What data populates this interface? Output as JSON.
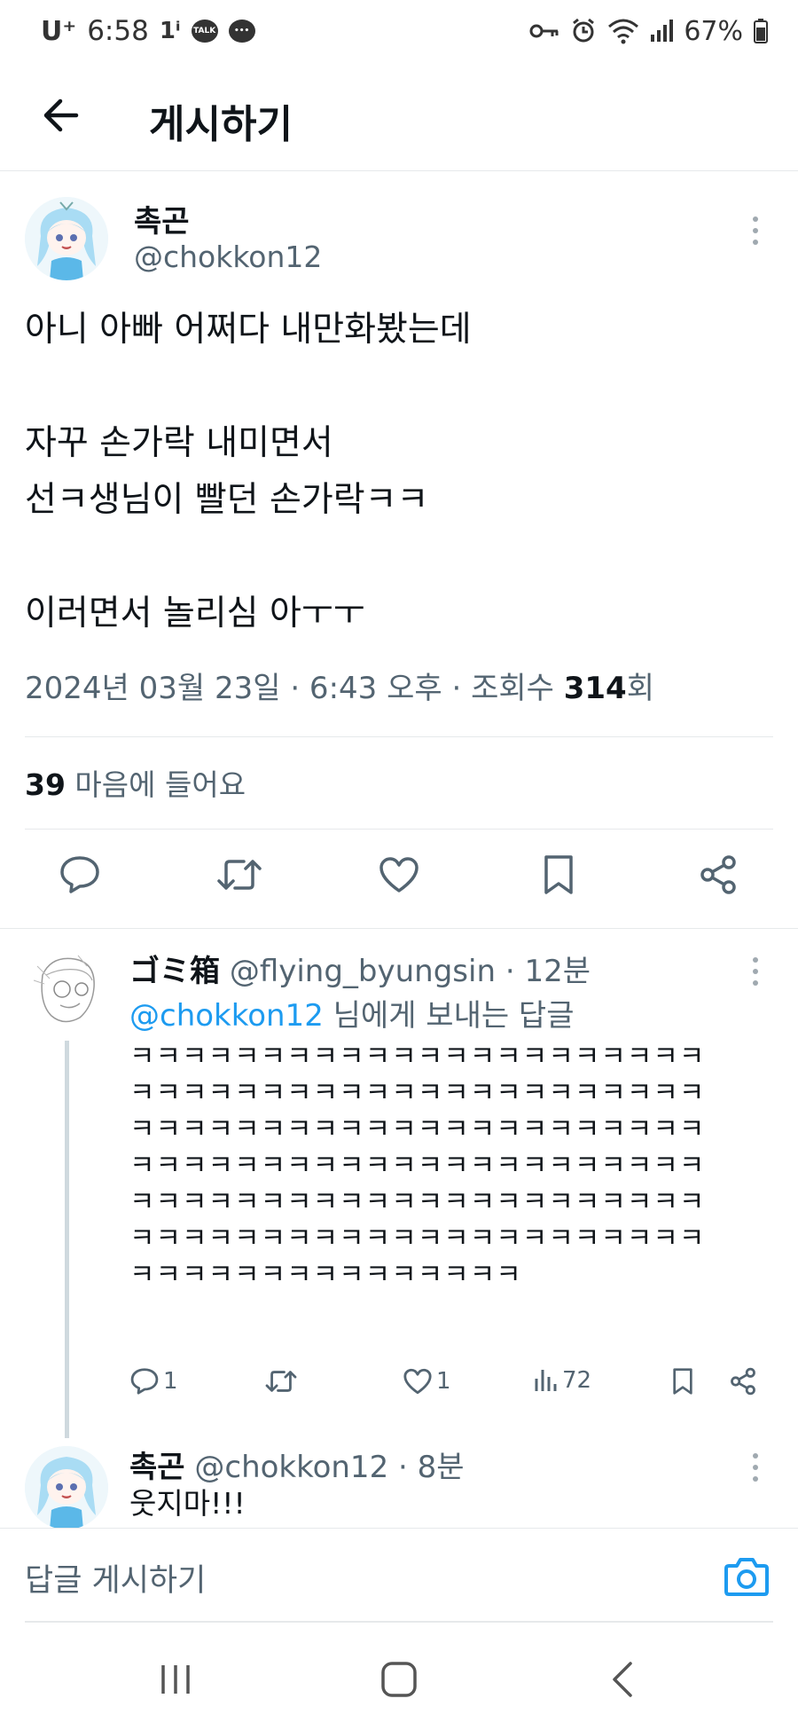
{
  "status_bar": {
    "carrier": "U⁺",
    "time": "6:58",
    "notification_count": "1ⁱ",
    "talk_label": "TALK",
    "battery": "67%"
  },
  "header": {
    "title": "게시하기"
  },
  "main_tweet": {
    "author_name": "촉곤",
    "author_handle": "@chokkon12",
    "body_lines": [
      "아니 아빠 어쩌다 내만화봤는데",
      "",
      "자꾸 손가락 내미면서",
      "선ㅋ생님이 빨던 손가락ㅋㅋ",
      "",
      "이러면서 놀리심 아ㅜㅜ"
    ],
    "meta_prefix": "2024년 03월 23일 · 6:43 오후 · 조회수 ",
    "meta_views": "314",
    "meta_suffix": "회",
    "likes_count": "39",
    "likes_label": " 마음에 들어요"
  },
  "replies": [
    {
      "author_name": "ゴミ箱",
      "author_handle": "@flying_byungsin · 12분",
      "reply_to_mention": "@chokkon12",
      "reply_to_text": " 님에게 보내는 답글",
      "body_lines": [
        "ㅋㅋㅋㅋㅋㅋㅋㅋㅋㅋㅋㅋㅋㅋㅋㅋㅋㅋㅋㅋㅋㅋ",
        "ㅋㅋㅋㅋㅋㅋㅋㅋㅋㅋㅋㅋㅋㅋㅋㅋㅋㅋㅋㅋㅋㅋ",
        "ㅋㅋㅋㅋㅋㅋㅋㅋㅋㅋㅋㅋㅋㅋㅋㅋㅋㅋㅋㅋㅋㅋ",
        "ㅋㅋㅋㅋㅋㅋㅋㅋㅋㅋㅋㅋㅋㅋㅋㅋㅋㅋㅋㅋㅋㅋ",
        "ㅋㅋㅋㅋㅋㅋㅋㅋㅋㅋㅋㅋㅋㅋㅋㅋㅋㅋㅋㅋㅋㅋ",
        "ㅋㅋㅋㅋㅋㅋㅋㅋㅋㅋㅋㅋㅋㅋㅋㅋㅋㅋㅋㅋㅋㅋ",
        "ㅋㅋㅋㅋㅋㅋㅋㅋㅋㅋㅋㅋㅋㅋㅋ"
      ],
      "reply_count": "1",
      "like_count": "1",
      "view_count": "72"
    },
    {
      "author_name": "촉곤",
      "author_handle": "@chokkon12 · 8분",
      "body": "웃지마!!!"
    }
  ],
  "composer": {
    "placeholder": "답글 게시하기"
  },
  "colors": {
    "accent": "#1d9bf0",
    "secondary_text": "#536471",
    "primary_text": "#0f1419",
    "divider": "#e6e9eb"
  },
  "icons": [
    "back-arrow-icon",
    "reply-icon",
    "retweet-icon",
    "heart-icon",
    "bookmark-icon",
    "share-icon",
    "views-icon",
    "camera-icon",
    "more-icon"
  ]
}
